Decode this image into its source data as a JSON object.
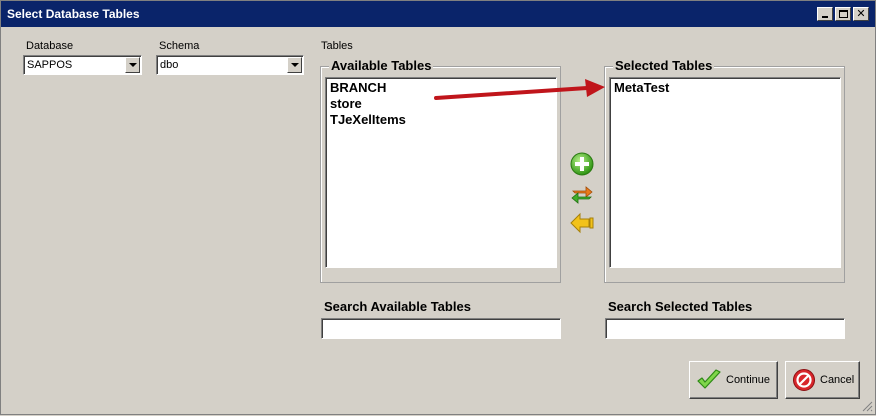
{
  "window": {
    "title": "Select Database Tables"
  },
  "database": {
    "label": "Database",
    "value": "SAPPOS"
  },
  "schema": {
    "label": "Schema",
    "value": "dbo"
  },
  "tables": {
    "label": "Tables",
    "available": {
      "title": "Available Tables",
      "items": [
        "BRANCH",
        "store",
        "TJeXelItems"
      ]
    },
    "selected": {
      "title": "Selected Tables",
      "items": [
        "MetaTest"
      ]
    }
  },
  "search": {
    "available_label": "Search Available Tables",
    "available_value": "",
    "selected_label": "Search Selected Tables",
    "selected_value": ""
  },
  "actions": {
    "add_icon": "plus-circle-icon",
    "swap_icon": "swap-arrows-icon",
    "remove_icon": "arrow-left-icon"
  },
  "buttons": {
    "continue_label": "Continue",
    "cancel_label": "Cancel"
  },
  "colors": {
    "titlebar": "#0a246a",
    "annotation_arrow": "#c0151b",
    "add_green": "#3aa81f",
    "remove_yellow": "#f0b800"
  }
}
